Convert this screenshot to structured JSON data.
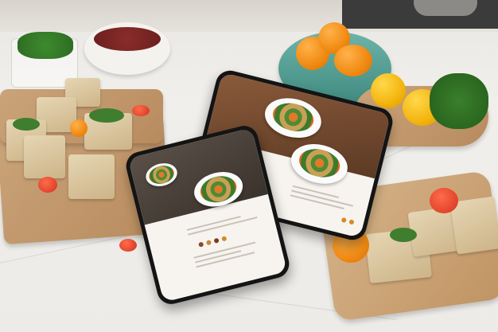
{
  "scene": {
    "description_hidden": "",
    "phones": [
      {
        "id": "phone-left",
        "screen_title": ""
      },
      {
        "id": "phone-back",
        "screen_title": ""
      }
    ]
  },
  "colors": {
    "counter": "#ecebe8",
    "board_wood": "#c49a6c",
    "orange_fruit": "#f08a12",
    "teal_bowl": "#5aa59a",
    "phone_body": "#141414"
  }
}
